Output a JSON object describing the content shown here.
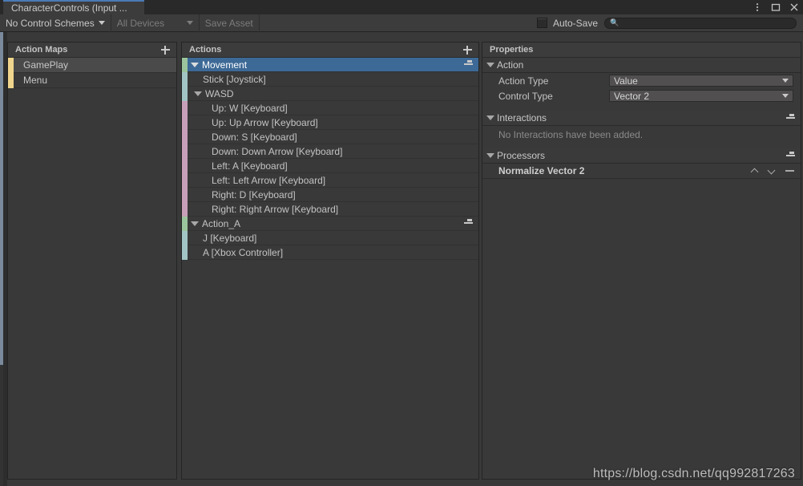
{
  "window": {
    "tab_title": "CharacterControls (Input ...",
    "controls": [
      {
        "name": "kebab-menu-icon",
        "glyph": "more"
      },
      {
        "name": "maximize-icon",
        "glyph": "maximize"
      },
      {
        "name": "close-icon",
        "glyph": "close"
      }
    ]
  },
  "toolbar": {
    "control_schemes_label": "No Control Schemes",
    "devices_label": "All Devices",
    "save_asset_label": "Save Asset",
    "autosave_label": "Auto-Save",
    "autosave_checked": false,
    "search_placeholder": "",
    "search_value": "",
    "search_icon": "search-icon"
  },
  "action_maps": {
    "header": "Action Maps",
    "add_icon": "plus-icon",
    "accent_color": "#f0d58c",
    "items": [
      {
        "label": "GamePlay",
        "selected": true
      },
      {
        "label": "Menu",
        "selected": false
      }
    ]
  },
  "actions": {
    "header": "Actions",
    "add_icon": "plus-icon",
    "colors": {
      "action": "#9cc49c",
      "binding": "#a2c4c4",
      "composite_part": "#c79fb8",
      "selected_row": "#3d6996"
    },
    "rows": [
      {
        "label": "Movement",
        "kind": "action",
        "accent": "acc-green",
        "indent": 0,
        "expandable": true,
        "selected": true,
        "has_add": true
      },
      {
        "label": "Stick [Joystick]",
        "kind": "binding",
        "accent": "acc-teal",
        "indent": 1,
        "expandable": false,
        "selected": false,
        "has_add": false
      },
      {
        "label": "WASD",
        "kind": "composite",
        "accent": "acc-teal",
        "indent": 0,
        "expandable": true,
        "selected": false,
        "has_add": false
      },
      {
        "label": "Up: W [Keyboard]",
        "kind": "composite_part",
        "accent": "acc-pink",
        "indent": 2,
        "expandable": false,
        "selected": false,
        "has_add": false
      },
      {
        "label": "Up: Up Arrow [Keyboard]",
        "kind": "composite_part",
        "accent": "acc-pink",
        "indent": 2,
        "expandable": false,
        "selected": false,
        "has_add": false
      },
      {
        "label": "Down: S [Keyboard]",
        "kind": "composite_part",
        "accent": "acc-pink",
        "indent": 2,
        "expandable": false,
        "selected": false,
        "has_add": false
      },
      {
        "label": "Down: Down Arrow [Keyboard]",
        "kind": "composite_part",
        "accent": "acc-pink",
        "indent": 2,
        "expandable": false,
        "selected": false,
        "has_add": false
      },
      {
        "label": "Left: A [Keyboard]",
        "kind": "composite_part",
        "accent": "acc-pink",
        "indent": 2,
        "expandable": false,
        "selected": false,
        "has_add": false
      },
      {
        "label": "Left: Left Arrow [Keyboard]",
        "kind": "composite_part",
        "accent": "acc-pink",
        "indent": 2,
        "expandable": false,
        "selected": false,
        "has_add": false
      },
      {
        "label": "Right: D [Keyboard]",
        "kind": "composite_part",
        "accent": "acc-pink",
        "indent": 2,
        "expandable": false,
        "selected": false,
        "has_add": false
      },
      {
        "label": "Right: Right Arrow [Keyboard]",
        "kind": "composite_part",
        "accent": "acc-pink",
        "indent": 2,
        "expandable": false,
        "selected": false,
        "has_add": false
      },
      {
        "label": "Action_A",
        "kind": "action",
        "accent": "acc-green",
        "indent": 0,
        "expandable": true,
        "selected": false,
        "has_add": true
      },
      {
        "label": "J [Keyboard]",
        "kind": "binding",
        "accent": "acc-teal",
        "indent": 1,
        "expandable": false,
        "selected": false,
        "has_add": false
      },
      {
        "label": "A [Xbox Controller]",
        "kind": "binding",
        "accent": "acc-teal",
        "indent": 1,
        "expandable": false,
        "selected": false,
        "has_add": false
      }
    ]
  },
  "properties": {
    "header": "Properties",
    "action_section": {
      "title": "Action",
      "fields": [
        {
          "label": "Action Type",
          "value": "Value"
        },
        {
          "label": "Control Type",
          "value": "Vector 2"
        }
      ]
    },
    "interactions_section": {
      "title": "Interactions",
      "add_icon": "plus-icon",
      "empty_text": "No Interactions have been added."
    },
    "processors_section": {
      "title": "Processors",
      "add_icon": "plus-icon",
      "items": [
        {
          "name": "Normalize Vector 2",
          "controls": [
            "move-up-icon",
            "move-down-icon",
            "remove-icon"
          ]
        }
      ]
    }
  },
  "watermark": "https://blog.csdn.net/qq992817263"
}
